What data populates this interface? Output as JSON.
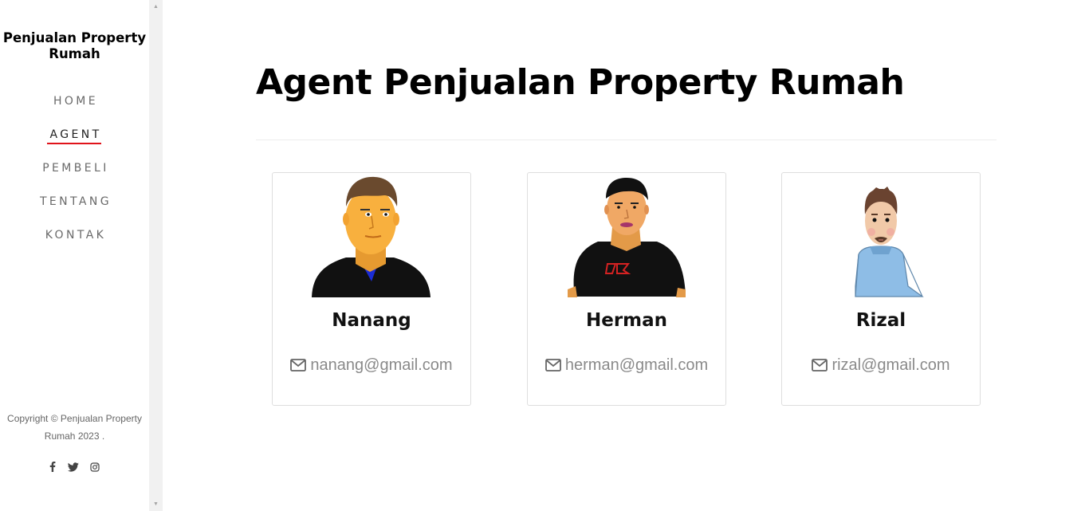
{
  "brand": {
    "line1": "Penjualan Property",
    "line2": "Rumah"
  },
  "nav": {
    "home": "HOME",
    "agent": "AGENT",
    "pembeli": "PEMBELI",
    "tentang": "TENTANG",
    "kontak": "KONTAK",
    "active": "AGENT",
    "active_color": "#e0131b"
  },
  "footer": {
    "copyright_line1": "Copyright © Penjualan Property",
    "copyright_line2": "Rumah 2023 .",
    "social_icons": [
      "facebook-icon",
      "twitter-icon",
      "instagram-icon"
    ]
  },
  "main": {
    "title": "Agent Penjualan Property Rumah"
  },
  "agents": [
    {
      "name": "Nanang",
      "email": "nanang@gmail.com",
      "avatar": "cartoon-man-black-shirt-blue-collar"
    },
    {
      "name": "Herman",
      "email": "herman@gmail.com",
      "avatar": "cartoon-man-black-tshirt-FR"
    },
    {
      "name": "Rizal",
      "email": "rizal@gmail.com",
      "avatar": "cartoon-man-blue-sweater-beard"
    }
  ]
}
